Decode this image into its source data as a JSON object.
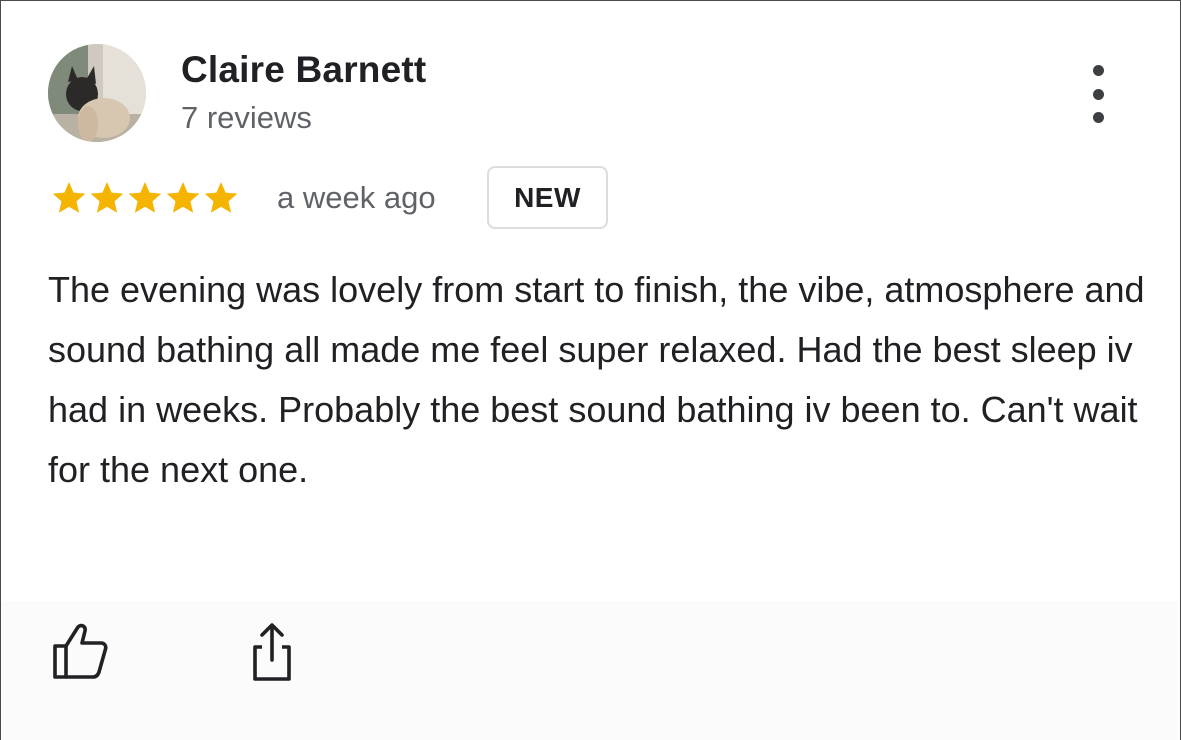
{
  "review": {
    "author_name": "Claire Barnett",
    "author_reviews": "7 reviews",
    "rating": 5,
    "rating_max": 5,
    "time_ago": "a week ago",
    "badge": "NEW",
    "text": "The evening was lovely from start to finish, the vibe, atmosphere and sound bathing all made me feel super relaxed. Had the best sleep iv had in weeks. Probably the best sound bathing iv been to. Can't wait for the next one."
  },
  "icons": {
    "more": "more-vert-icon",
    "star": "star-icon",
    "like": "thumbs-up-icon",
    "share": "share-icon"
  },
  "colors": {
    "star": "#f4b400",
    "text": "#202124",
    "secondary_text": "#5f6368",
    "badge_border": "#dadce0"
  }
}
